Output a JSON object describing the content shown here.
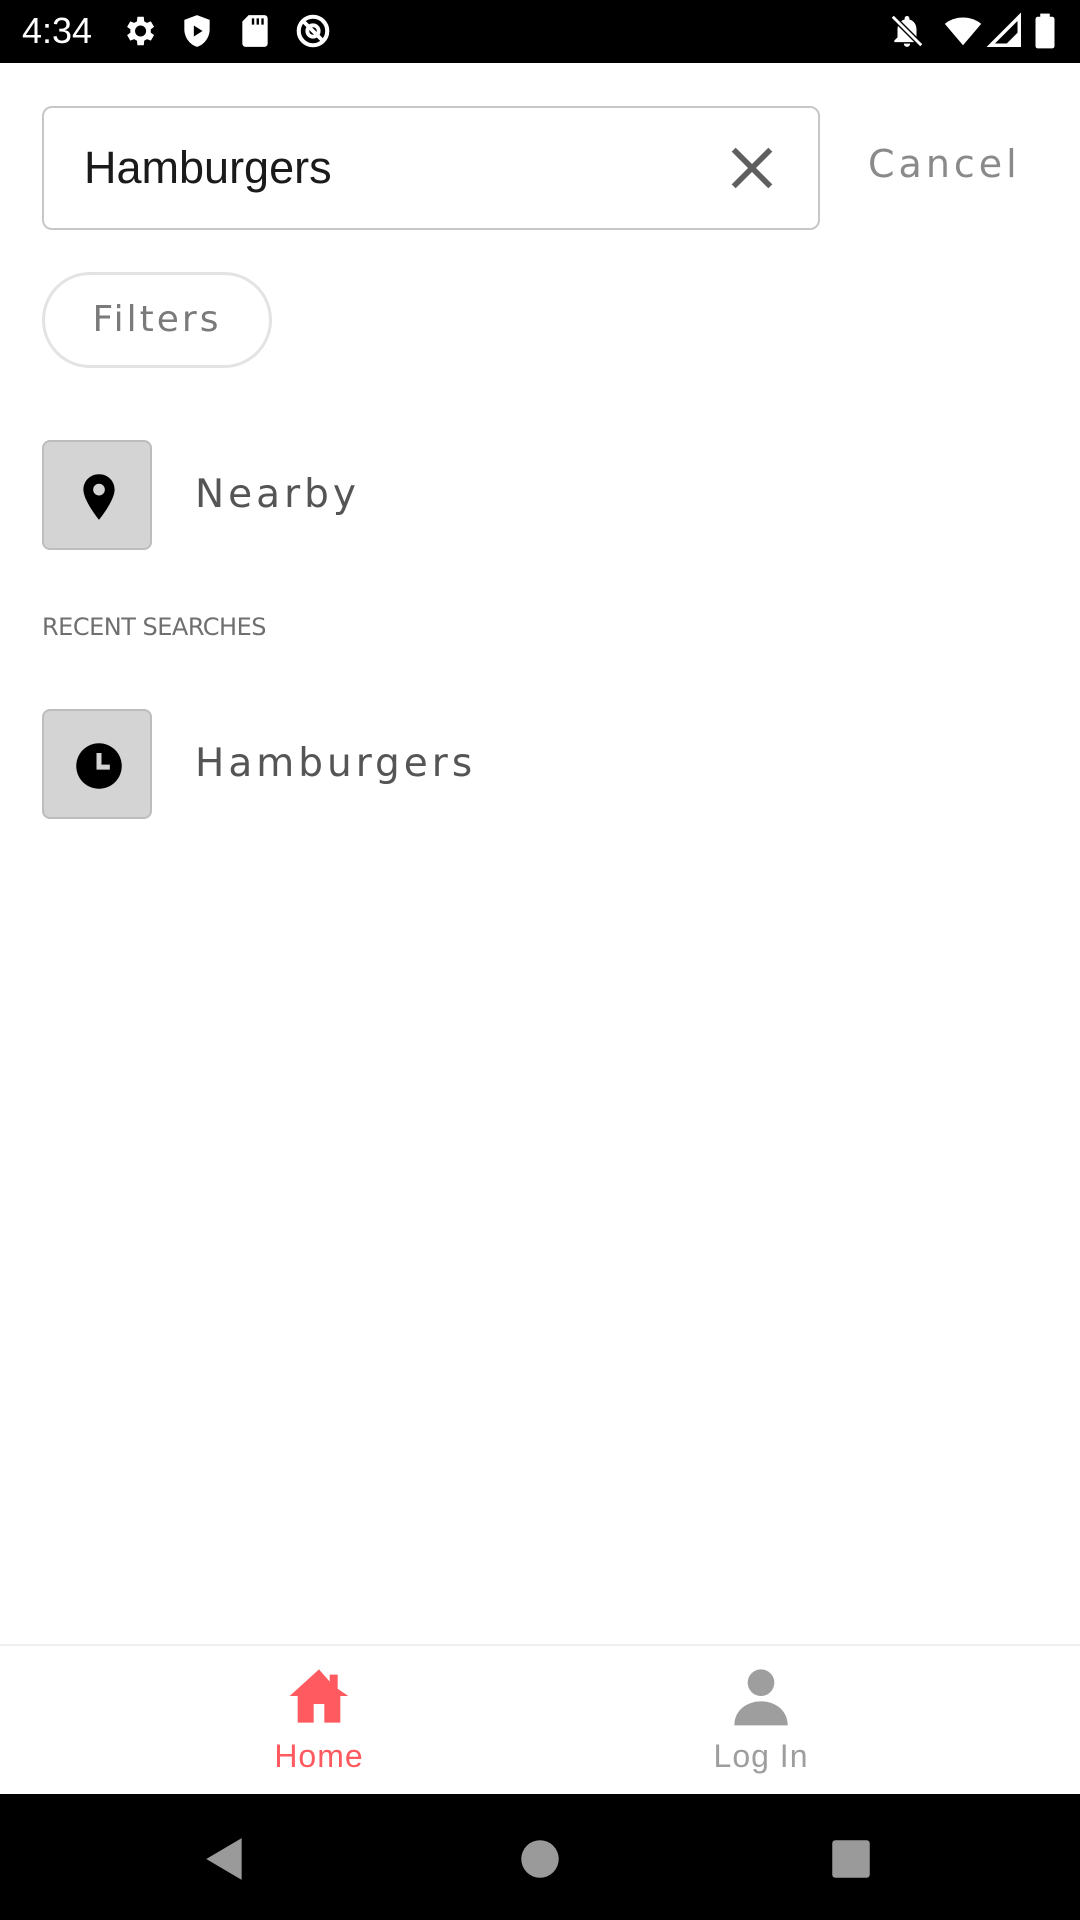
{
  "status_bar": {
    "time": "4:34",
    "left_icons": [
      "gear-icon",
      "shield-icon",
      "sd-card-icon",
      "at-sign-icon"
    ],
    "right_icons": [
      "notifications-off-icon",
      "wifi-icon",
      "cell-signal-icon",
      "battery-icon"
    ]
  },
  "search": {
    "value": "Hamburgers",
    "clear_icon": "close-icon",
    "cancel_label": "Cancel"
  },
  "filters": {
    "label": "Filters"
  },
  "nearby": {
    "icon": "location-pin-icon",
    "label": "Nearby"
  },
  "recent": {
    "header": "RECENT SEARCHES",
    "items": [
      {
        "icon": "clock-icon",
        "label": "Hamburgers"
      }
    ]
  },
  "bottom_nav": {
    "accent_color": "#ff5a5f",
    "inactive_color": "#9e9e9e",
    "items": [
      {
        "icon": "home-icon",
        "label": "Home",
        "active": true
      },
      {
        "icon": "person-icon",
        "label": "Log In",
        "active": false
      }
    ]
  },
  "system_nav": {
    "buttons": [
      "back-icon",
      "home-circle-icon",
      "recents-square-icon"
    ]
  }
}
